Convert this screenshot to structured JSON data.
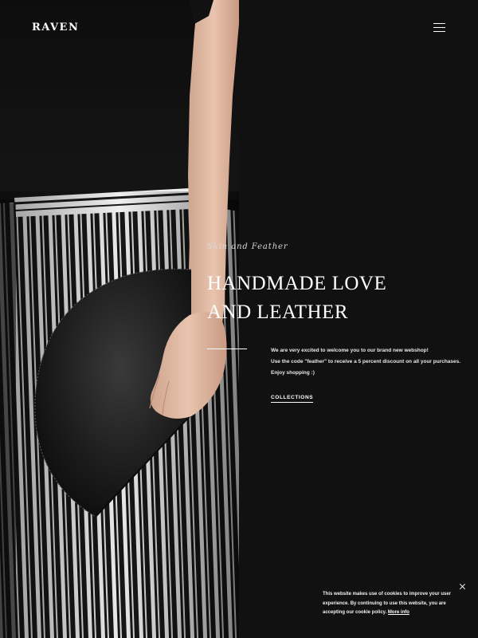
{
  "header": {
    "logo": "RAVEN",
    "menu_icon": "hamburger-menu-icon"
  },
  "hero": {
    "subtitle": "Skin and Feather",
    "headline_line1": "HANDMADE LOVE",
    "headline_line2": "AND LEATHER",
    "intro_line1": "We are very excited to welcome you to our brand new webshop!",
    "intro_line2": "Use the code \"feather\" to receive a 5 percent discount on all your purchases.",
    "intro_line3": "Enjoy shopping :)",
    "cta_label": "COLLECTIONS"
  },
  "image": {
    "subject": "model in black top and black-and-white striped trousers holding a black half-moon leather clutch"
  },
  "cookie_notice": {
    "line1": "This website makes use of cookies to improve your user",
    "line2": "experience. By continuing to use this website, you are",
    "line3_text": "accepting our cookie policy.",
    "more_info": "More info",
    "close_icon": "close-icon"
  },
  "colors": {
    "background": "#111111",
    "text": "#ffffff",
    "accent": "#ffffff"
  }
}
